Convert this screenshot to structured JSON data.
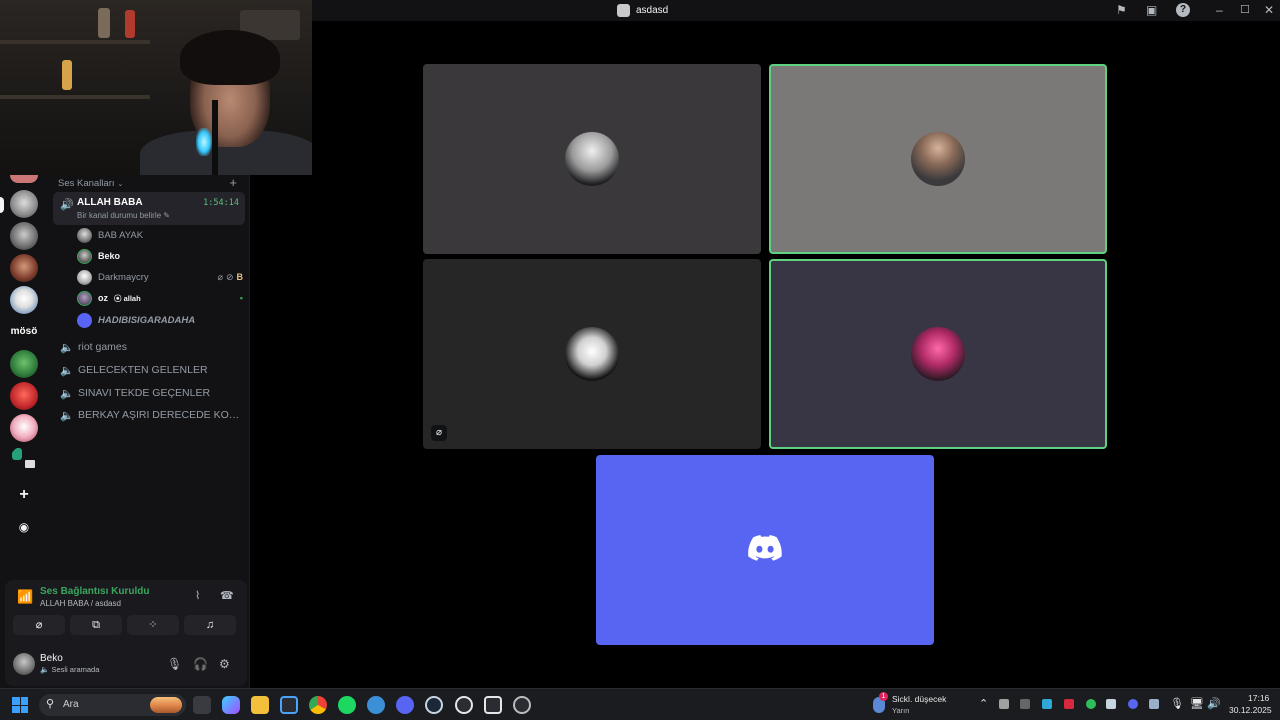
{
  "window": {
    "title": "asdasd",
    "icons": [
      "inbox-flag-icon",
      "help-icon",
      "minimize-icon",
      "maximize-icon",
      "close-icon"
    ]
  },
  "server_rail": {
    "text_label": "mösö"
  },
  "channels": {
    "category_label": "Ses Kanalları",
    "active": {
      "name": "ALLAH BABA",
      "status_placeholder": "Bir kanal durumu belirle",
      "timer": "1:54:14"
    },
    "members": [
      {
        "name": "BAB AYAK",
        "style": "normal"
      },
      {
        "name": "Beko",
        "style": "bold"
      },
      {
        "name": "Darkmaycry",
        "style": "normal"
      },
      {
        "name": "oz",
        "tag": "allah",
        "style": "bold"
      },
      {
        "name": "HADIBISIGARADAHA",
        "style": "italic"
      }
    ],
    "voice_channels": [
      {
        "name": "riot games"
      },
      {
        "name": "GELECEKTEN GELENLER"
      },
      {
        "name": "SINAVI TEKDE GEÇENLER"
      },
      {
        "name": "BERKAY AŞIRI DERECEDE KOMİ..."
      }
    ]
  },
  "voice_panel": {
    "title": "Ses Bağlantısı Kuruldu",
    "subtitle": "ALLAH BABA / asdasd"
  },
  "user": {
    "name": "Beko",
    "status": "Sesli aramada"
  },
  "stage": {
    "tiles": [
      {
        "id": "tile-1",
        "speaking": false,
        "muted": false,
        "bg": "#3a383b"
      },
      {
        "id": "tile-2",
        "speaking": true,
        "muted": false,
        "bg": "#7b7978"
      },
      {
        "id": "tile-3",
        "speaking": false,
        "muted": true,
        "bg": "#262627"
      },
      {
        "id": "tile-4",
        "speaking": true,
        "muted": false,
        "bg": "#383544"
      },
      {
        "id": "tile-5",
        "speaking": false,
        "muted": false,
        "bg": "#5865f2"
      }
    ],
    "speaking_color": "#5fd17f"
  },
  "taskbar": {
    "search_label": "Ara",
    "weather_title": "Sickl. düşecek",
    "weather_sub": "Yarın",
    "weather_badge": "1",
    "time": "17:16",
    "date": "30.12.2025"
  },
  "colors": {
    "accent_green": "#3ba55d",
    "discord_blurple": "#5865f2",
    "sidebar_bg": "#121214"
  }
}
